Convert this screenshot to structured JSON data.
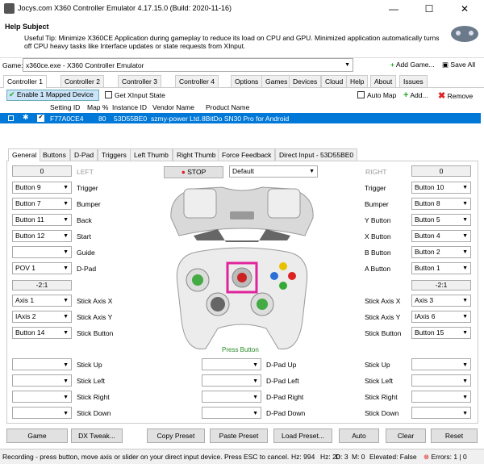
{
  "window": {
    "title": "Jocys.com X360 Controller Emulator 4.17.15.0 (Build: 2020-11-16)",
    "minimize": "—",
    "maximize": "☐",
    "close": "✕"
  },
  "help": {
    "subject": "Help Subject",
    "tip": "Useful Tip: Minimize X360CE Application during gameplay to reduce its load on CPU and GPU. Minimized application automatically turns off CPU heavy tasks like Interface updates or state requests from XInput."
  },
  "gamebar": {
    "label": "Game:",
    "value": "x360ce.exe - X360 Controller Emulator",
    "add": "Add Game...",
    "save": "Save All"
  },
  "main_tabs": [
    "Controller 1",
    "Controller 2",
    "Controller 3",
    "Controller 4",
    "Options",
    "Games",
    "Devices",
    "Cloud",
    "Help",
    "About",
    "Issues"
  ],
  "toolbar": {
    "enable": "Enable 1 Mapped Device",
    "xinput": "Get XInput State",
    "automap": "Auto Map",
    "add": "Add...",
    "remove": "Remove"
  },
  "device_headers": [
    "Setting ID",
    "Map %",
    "Instance ID",
    "Vendor Name",
    "Product Name"
  ],
  "device_row": {
    "setting_id": "F77A0CE4",
    "map": "80",
    "instance": "53D55BE0",
    "vendor": "szmy-power Ltd.",
    "product": "8BitDo SN30 Pro for Android"
  },
  "sub_tabs": [
    "General",
    "Buttons",
    "D-Pad",
    "Triggers",
    "Left Thumb",
    "Right Thumb",
    "Force Feedback",
    "Direct Input - 53D55BE0"
  ],
  "general": {
    "left_val": "0",
    "left": "LEFT",
    "stop": "STOP",
    "preset": "Default",
    "right": "RIGHT",
    "right_val": "0",
    "dead_left": "-2:1",
    "dead_right": "-2:1",
    "press": "Press Button"
  },
  "left_rows": [
    {
      "v": "Button 9",
      "l": "Trigger"
    },
    {
      "v": "Button 7",
      "l": "Bumper"
    },
    {
      "v": "Button 11",
      "l": "Back"
    },
    {
      "v": "Button 12",
      "l": "Start"
    },
    {
      "v": "",
      "l": "Guide"
    },
    {
      "v": "POV 1",
      "l": "D-Pad"
    }
  ],
  "right_rows": [
    {
      "v": "Button 10",
      "l": "Trigger"
    },
    {
      "v": "Button 8",
      "l": "Bumper"
    },
    {
      "v": "Button 5",
      "l": "Y Button"
    },
    {
      "v": "Button 4",
      "l": "X Button"
    },
    {
      "v": "Button 2",
      "l": "B Button"
    },
    {
      "v": "Button 1",
      "l": "A Button"
    }
  ],
  "left_axes": [
    {
      "v": "Axis 1",
      "l": "Stick Axis X"
    },
    {
      "v": "IAxis 2",
      "l": "Stick Axis Y"
    },
    {
      "v": "Button 14",
      "l": "Stick Button"
    }
  ],
  "right_axes": [
    {
      "v": "Axis 3",
      "l": "Stick Axis X"
    },
    {
      "v": "IAxis 6",
      "l": "Stick Axis Y"
    },
    {
      "v": "Button 15",
      "l": "Stick Button"
    }
  ],
  "bottom_left": [
    "Stick Up",
    "Stick Left",
    "Stick Right",
    "Stick Down"
  ],
  "bottom_mid": [
    "D-Pad Up",
    "D-Pad Left",
    "D-Pad Right",
    "D-Pad Down"
  ],
  "bottom_right": [
    "Stick Up",
    "Stick Left",
    "Stick Right",
    "Stick Down"
  ],
  "buttons": [
    "Game",
    "DX Tweak...",
    "Copy Preset",
    "Paste Preset",
    "Load Preset...",
    "Auto",
    "Clear",
    "Reset"
  ],
  "status": {
    "msg": "Recording - press button, move axis or slider on your direct input device. Press ESC to cancel.",
    "hz": "Hz: 994",
    "fps": "Hz: 20",
    "d": "D: 3",
    "m": "M: 0",
    "elevated": "Elevated: False",
    "errors": "Errors: 1 | 0"
  }
}
